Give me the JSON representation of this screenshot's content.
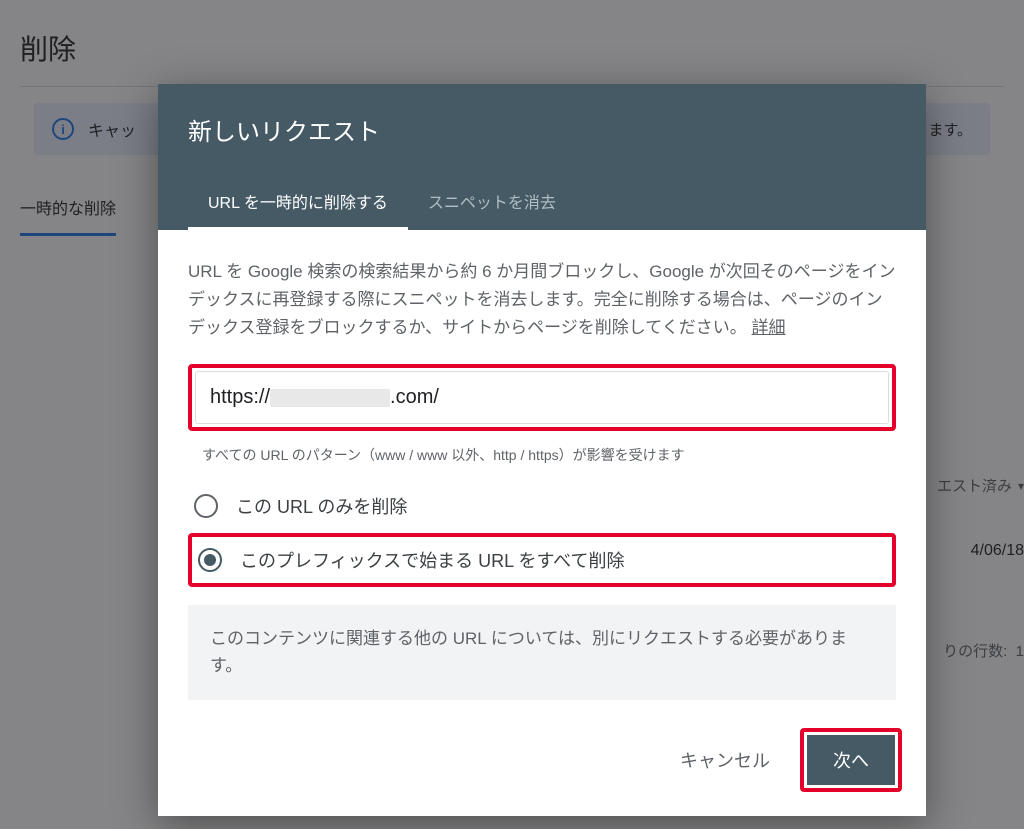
{
  "background": {
    "page_title": "削除",
    "banner_prefix": "キャッ",
    "banner_suffix": "ます。",
    "tab_temp_remove": "一時的な削除",
    "side_status": "エスト済み",
    "side_date": "4/06/18",
    "side_rows": "りの行数:",
    "side_rows_val": "1"
  },
  "modal": {
    "title": "新しいリクエスト",
    "tabs": {
      "temp_remove": "URL を一時的に削除する",
      "clear_snippet": "スニペットを消去"
    },
    "description": "URL を Google 検索の検索結果から約 6 か月間ブロックし、Google が次回そのページをインデックスに再登録する際にスニペットを消去します。完全に削除する場合は、ページのインデックス登録をブロックするか、サイトからページを削除してください。",
    "learn_more": "詳細",
    "url_prefix": "https://",
    "url_suffix": ".com/",
    "help_text": "すべての URL のパターン（www / www 以外、http / https）が影響を受けます",
    "radio": {
      "only_this": "この URL のみを削除",
      "prefix_all": "このプレフィックスで始まる URL をすべて削除"
    },
    "note": "このコンテンツに関連する他の URL については、別にリクエストする必要があります。",
    "cancel": "キャンセル",
    "next": "次へ"
  }
}
